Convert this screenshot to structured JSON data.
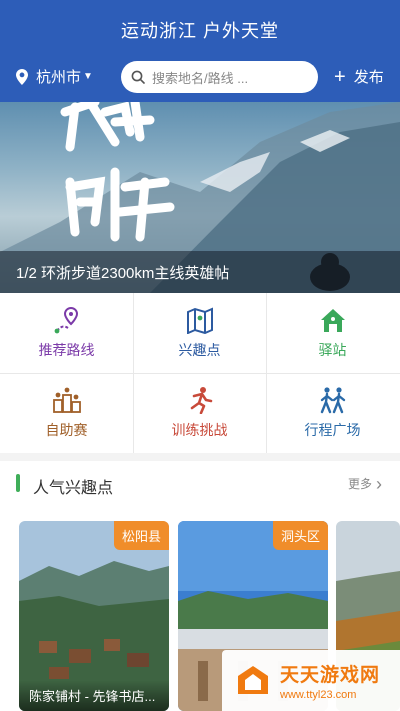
{
  "header": {
    "title": "运动浙江 户外天堂",
    "city": "杭州市",
    "search_placeholder": "搜索地名/路线 ...",
    "publish_label": "发布"
  },
  "banner": {
    "caption": "1/2 环浙步道2300km主线英雄帖",
    "calligraphy": "雄帖"
  },
  "grid": [
    {
      "label": "推荐路线",
      "icon": "route-pin-icon",
      "color": "#7b3aa8"
    },
    {
      "label": "兴趣点",
      "icon": "map-icon",
      "color": "#2c5aa0"
    },
    {
      "label": "驿站",
      "icon": "house-icon",
      "color": "#3aa85a"
    },
    {
      "label": "自助赛",
      "icon": "podium-icon",
      "color": "#a0602a"
    },
    {
      "label": "训练挑战",
      "icon": "runner-icon",
      "color": "#c84a3a"
    },
    {
      "label": "行程广场",
      "icon": "hikers-icon",
      "color": "#2a6aa8"
    }
  ],
  "section": {
    "title": "人气兴趣点",
    "more": "更多"
  },
  "cards": [
    {
      "tag": "松阳县",
      "name": "陈家铺村 - 先锋书店..."
    },
    {
      "tag": "洞头区",
      "name": ""
    },
    {
      "tag": "",
      "name": ""
    }
  ],
  "watermark": {
    "name": "天天游戏网",
    "url": "www.ttyl23.com"
  }
}
